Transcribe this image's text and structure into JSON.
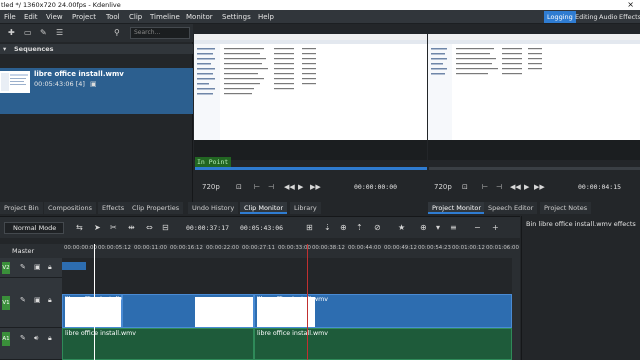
{
  "window": {
    "title": "tled */ 1360x720 24.00fps - Kdenlive",
    "close_glyph": "×"
  },
  "menu": {
    "items": [
      "File",
      "Edit",
      "View",
      "Project",
      "Tool",
      "Clip",
      "Timeline",
      "Monitor",
      "Settings",
      "Help"
    ],
    "workspaces": [
      "Logging",
      "Editing",
      "Audio",
      "Effects"
    ],
    "active_workspace": "Logging"
  },
  "bin": {
    "search_placeholder": "Search...",
    "sequences_label": "Sequences",
    "clip": {
      "name": "libre office install.wmv",
      "meta": "00:05:43:06 [4]"
    }
  },
  "clip_monitor": {
    "in_point_label": "In Point",
    "zoom": "720p",
    "timecode": "00:00:00:00",
    "accent": "#2f7cd1"
  },
  "project_monitor": {
    "zoom": "720p",
    "timecode": "00:00:04:15"
  },
  "dock_tabs": {
    "left": [
      "Project Bin",
      "Compositions",
      "Effects",
      "Clip Properties",
      "Undo History"
    ],
    "middle": [
      "Clip Monitor",
      "Library"
    ],
    "right": [
      "Project Monitor",
      "Speech Editor",
      "Project Notes"
    ],
    "active": [
      "Clip Monitor",
      "Project Monitor"
    ]
  },
  "timeline": {
    "mode": "Normal Mode",
    "position": "00:00:37:17",
    "duration": "00:05:43:06",
    "master_label": "Master",
    "ruler_ticks": [
      "00:00:00:00",
      "00:00:05:12",
      "00:00:11:00",
      "00:00:16:12",
      "00:00:22:00",
      "00:00:27:11",
      "00:00:33:00",
      "00:00:38:12",
      "00:00:44:00",
      "00:00:49:12",
      "00:00:54:23",
      "00:01:00:12",
      "00:01:06:00"
    ],
    "tracks": [
      {
        "label": "V2",
        "color": "#3a8f3a"
      },
      {
        "label": "V1",
        "color": "#3a8f3a"
      },
      {
        "label": "A1",
        "color": "#3a8f3a"
      }
    ],
    "clips": {
      "video_name": "libre office install.wmv",
      "audio_name": "libre office install.wmv"
    }
  },
  "effects_panel": {
    "title": "Bin libre office install.wmv effects"
  }
}
